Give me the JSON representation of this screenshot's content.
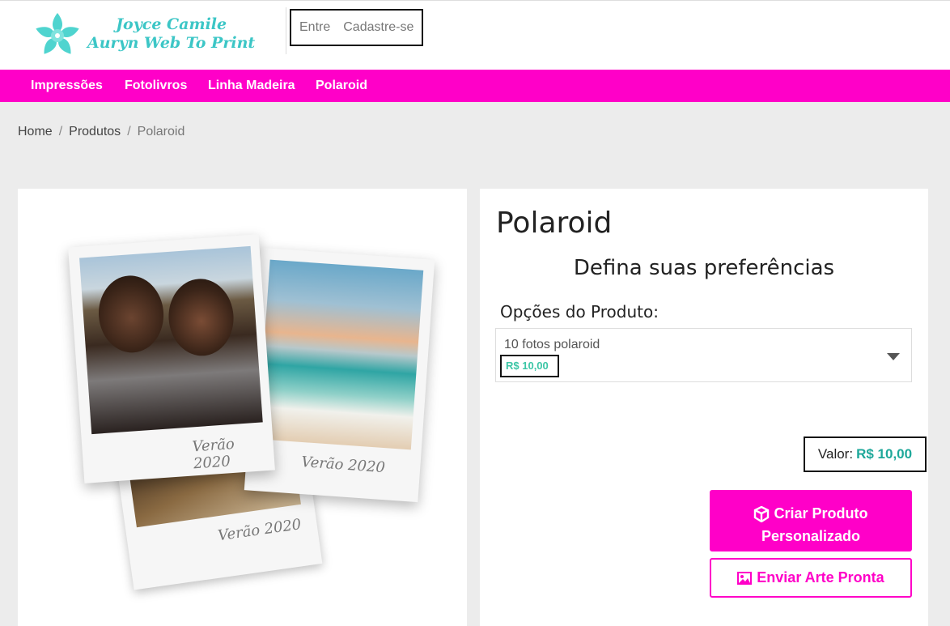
{
  "brand": {
    "line1": "Joyce Camile",
    "line2": "Auryn Web To Print"
  },
  "auth": {
    "login": "Entre",
    "signup": "Cadastre-se"
  },
  "nav": [
    "Impressões",
    "Fotolivros",
    "Linha Madeira",
    "Polaroid"
  ],
  "breadcrumb": {
    "home": "Home",
    "products": "Produtos",
    "current": "Polaroid"
  },
  "product": {
    "title": "Polaroid",
    "prefs_heading": "Defina suas preferências",
    "options_label": "Opções do Produto:",
    "selected_option": "10 fotos polaroid",
    "selected_price": "R$ 10,00",
    "value_label": "Valor:",
    "value_amount": "R$ 10,00",
    "create_button": [
      "Criar Produto",
      "Personalizado"
    ],
    "send_button": "Enviar Arte Pronta"
  },
  "polaroid_captions": [
    "Verão 2020",
    "Verão 2020",
    "Verão 2020"
  ],
  "colors": {
    "accent": "#ff00c8",
    "brand_teal": "#3cc6c6",
    "price_teal": "#1ea89a"
  },
  "icons": {
    "logo": "flower-logo-icon",
    "create": "cube-icon",
    "send": "image-icon",
    "select": "caret-down-icon"
  }
}
